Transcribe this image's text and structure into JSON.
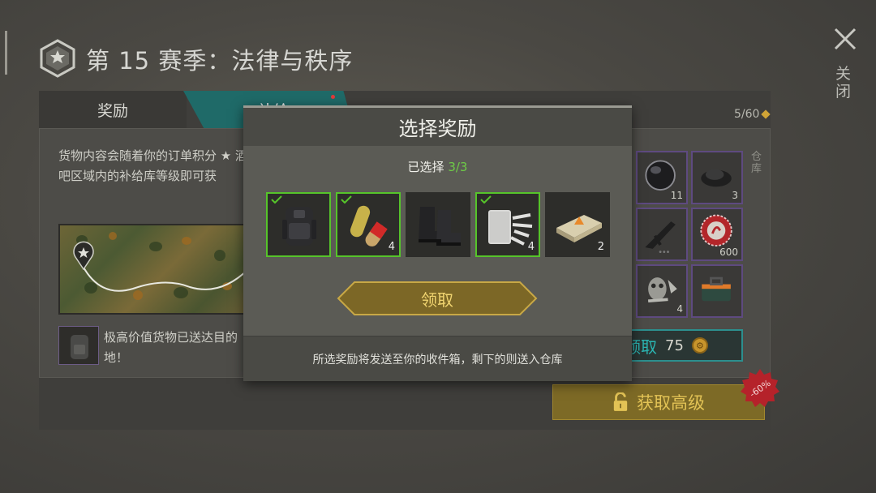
{
  "header": {
    "season_title": "第 15 赛季：法律与秩序",
    "close_label": "关闭"
  },
  "tabs": [
    {
      "label": "奖励"
    },
    {
      "label": "补给"
    }
  ],
  "progress": {
    "text": "5/60"
  },
  "description": "货物内容会随着你的订单积分 ★ 酒吧区域内的补给库等级即可获",
  "note": {
    "text": "极高价值货物已送达目的地！"
  },
  "warehouse_label": "仓库",
  "grid_items": [
    {
      "icon": "lens-icon",
      "qty": "11"
    },
    {
      "icon": "ore-pile-icon",
      "qty": "3"
    },
    {
      "icon": "rifle-icon",
      "qty": ""
    },
    {
      "icon": "bottle-cap-icon",
      "qty": "600"
    },
    {
      "icon": "mask-parts-icon",
      "qty": "4"
    },
    {
      "icon": "toolbox-icon",
      "qty": ""
    }
  ],
  "claim_bg_button": {
    "label": "领取",
    "cost": "75"
  },
  "premium_button": {
    "label": "获取高级"
  },
  "discount": "-60%",
  "modal": {
    "title": "选择奖励",
    "selected_prefix": "已选择 ",
    "selected_count": "3/3",
    "claim_label": "领取",
    "footer": "所选奖励将发送至你的收件箱，剩下的则送入仓库",
    "rewards": [
      {
        "icon": "backpack-icon",
        "selected": true,
        "qty": ""
      },
      {
        "icon": "pills-icon",
        "selected": true,
        "qty": "4"
      },
      {
        "icon": "boots-icon",
        "selected": false,
        "qty": ""
      },
      {
        "icon": "bandage-roll-icon",
        "selected": true,
        "qty": "4"
      },
      {
        "icon": "explosive-brick-icon",
        "selected": false,
        "qty": "2"
      }
    ]
  },
  "colors": {
    "selected_border": "#56c42a",
    "teal_accent": "#1f6a68",
    "gold": "#e3c355"
  }
}
